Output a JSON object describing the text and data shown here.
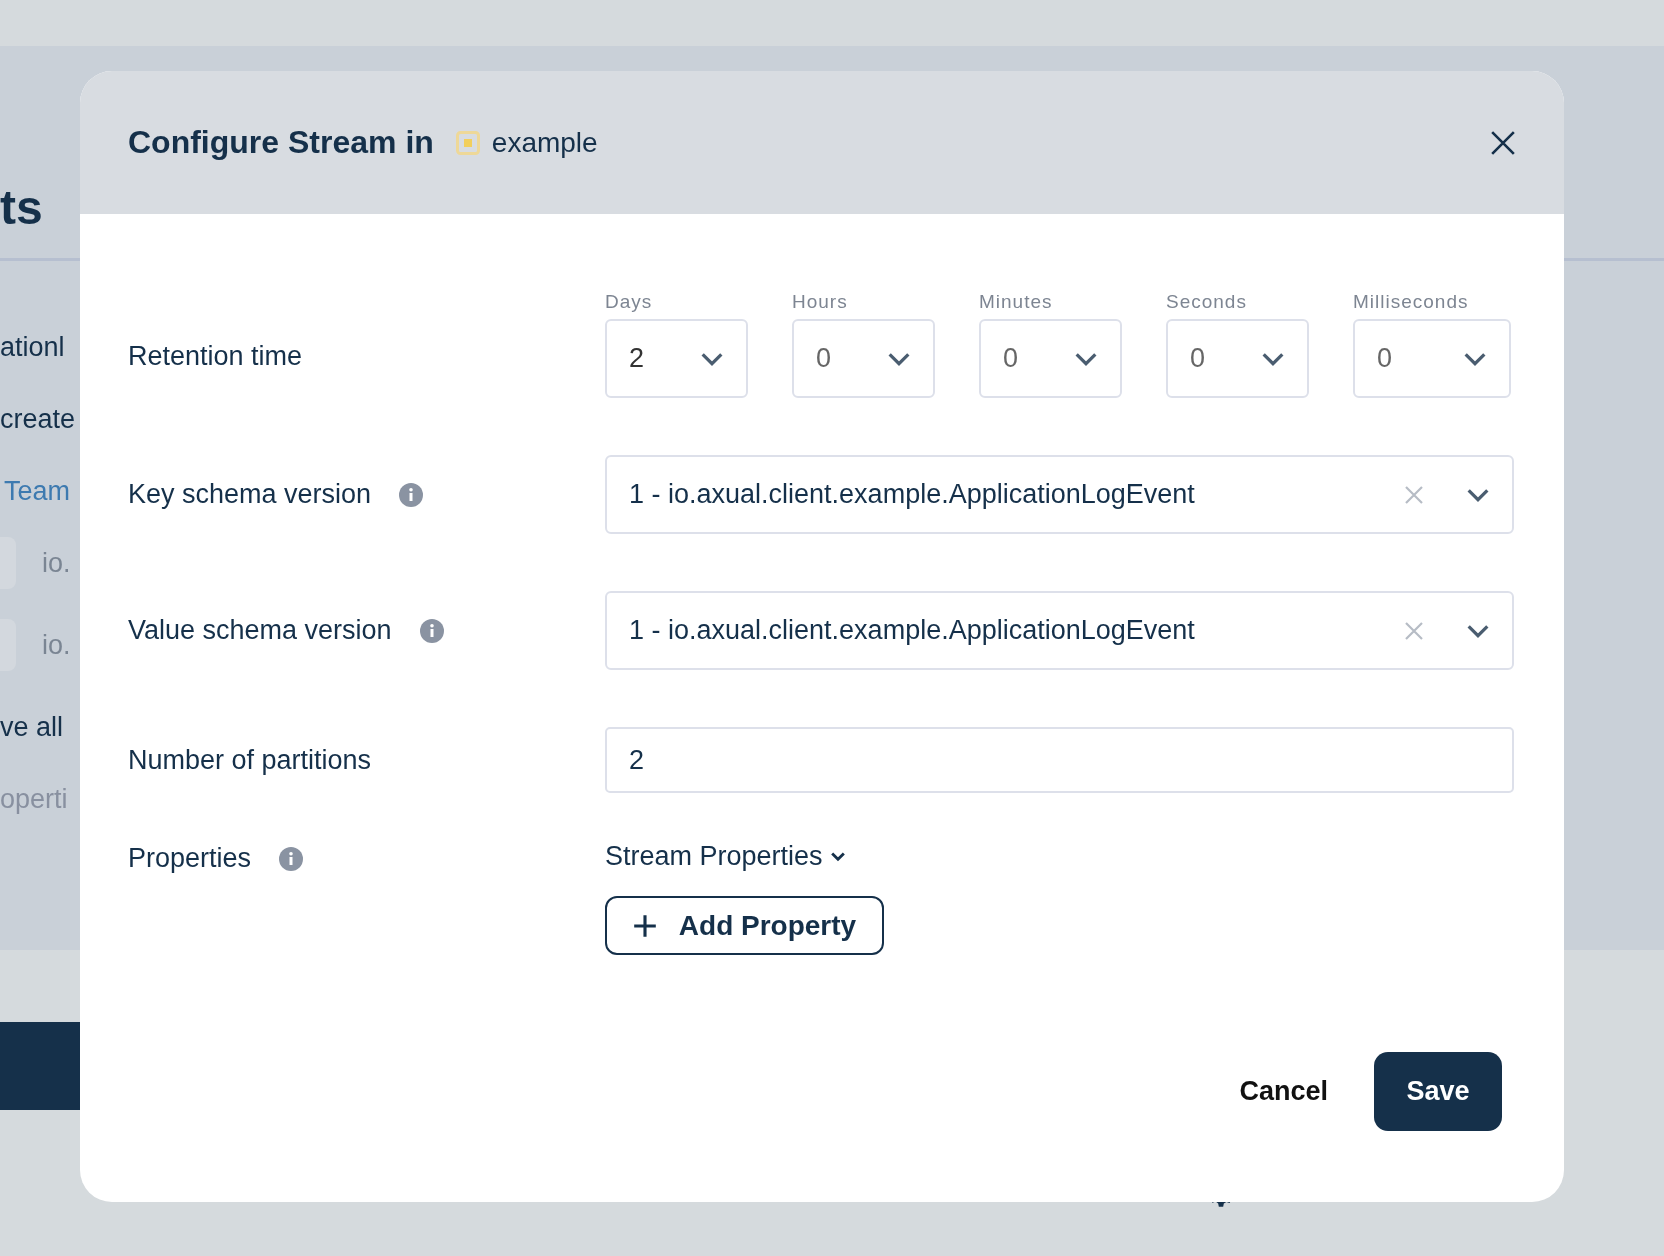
{
  "background": {
    "heading": "ts",
    "lines": [
      {
        "text": "ationl",
        "kind": "text"
      },
      {
        "text": "create",
        "kind": "text"
      },
      {
        "text": "Team",
        "kind": "link"
      },
      {
        "text": "io.",
        "kind": "chip"
      },
      {
        "text": "io.",
        "kind": "chip"
      },
      {
        "text": "ve all",
        "kind": "text"
      },
      {
        "text": "operti",
        "kind": "muted"
      }
    ]
  },
  "modal": {
    "title": "Configure Stream in",
    "environment": "example",
    "retention": {
      "label": "Retention time",
      "units": [
        {
          "label": "Days",
          "value": "2"
        },
        {
          "label": "Hours",
          "value": "0"
        },
        {
          "label": "Minutes",
          "value": "0"
        },
        {
          "label": "Seconds",
          "value": "0"
        },
        {
          "label": "Milliseconds",
          "value": "0"
        }
      ]
    },
    "key_schema": {
      "label": "Key schema version",
      "value": "1 - io.axual.client.example.ApplicationLogEvent"
    },
    "value_schema": {
      "label": "Value schema version",
      "value": "1 - io.axual.client.example.ApplicationLogEvent"
    },
    "partitions": {
      "label": "Number of partitions",
      "value": "2"
    },
    "properties": {
      "label": "Properties",
      "toggle": "Stream Properties",
      "add_button": "Add Property"
    },
    "buttons": {
      "cancel": "Cancel",
      "save": "Save"
    }
  }
}
